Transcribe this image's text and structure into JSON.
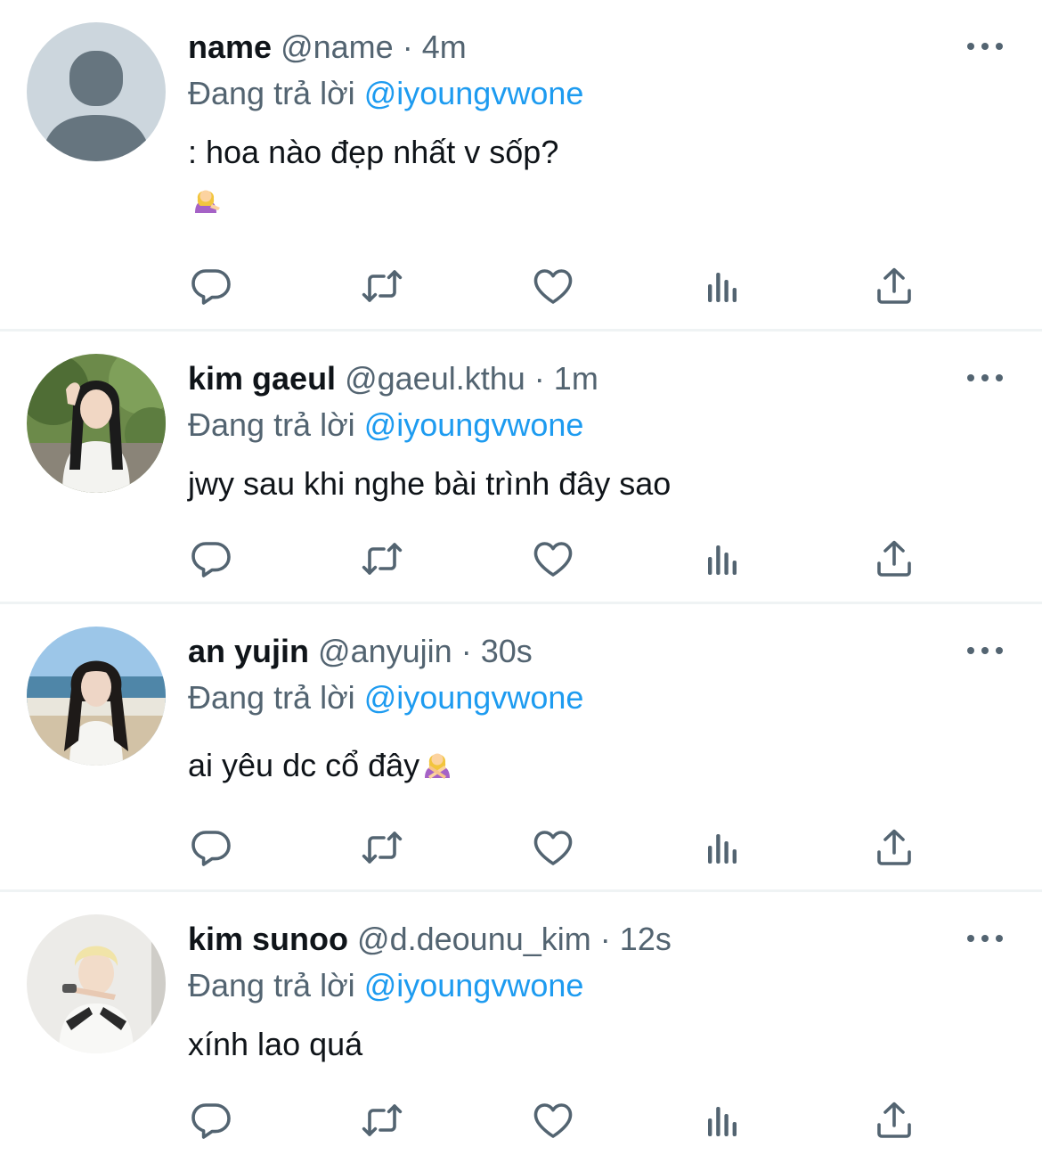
{
  "tweets": [
    {
      "name": "name",
      "handle": "@name",
      "sep": "·",
      "time": "4m",
      "reply_prefix": "Đang trả lời",
      "reply_to": "@iyoungvwone",
      "text": ": hoa nào đẹp nhất v sốp?",
      "emoji": "person-tipping-hand-emoji",
      "avatar": "default-avatar"
    },
    {
      "name": "kim gaeul",
      "handle": "@gaeul.kthu",
      "sep": "·",
      "time": "1m",
      "reply_prefix": "Đang trả lời",
      "reply_to": "@iyoungvwone",
      "text": "jwy sau khi nghe bài trình đây sao",
      "avatar": "photo-avatar"
    },
    {
      "name": "an yujin",
      "handle": "@anyujin",
      "sep": "·",
      "time": "30s",
      "reply_prefix": "Đang trả lời",
      "reply_to": "@iyoungvwone",
      "text": "ai yêu dc cổ đây",
      "emoji": "person-gesturing-no-emoji",
      "avatar": "photo-avatar"
    },
    {
      "name": "kim sunoo",
      "handle": "@d.deounu_kim",
      "sep": "·",
      "time": "12s",
      "reply_prefix": "Đang trả lời",
      "reply_to": "@iyoungvwone",
      "text": "xính lao quá",
      "avatar": "photo-avatar"
    }
  ],
  "actions": [
    "reply-icon",
    "retweet-icon",
    "like-icon",
    "views-icon",
    "share-icon"
  ],
  "colors": {
    "text_primary": "#0f1419",
    "text_secondary": "#536471",
    "mention": "#1d9bf0",
    "divider": "#eff3f4",
    "default_avatar_bg": "#ccd6dd",
    "default_avatar_fg": "#66757f"
  }
}
